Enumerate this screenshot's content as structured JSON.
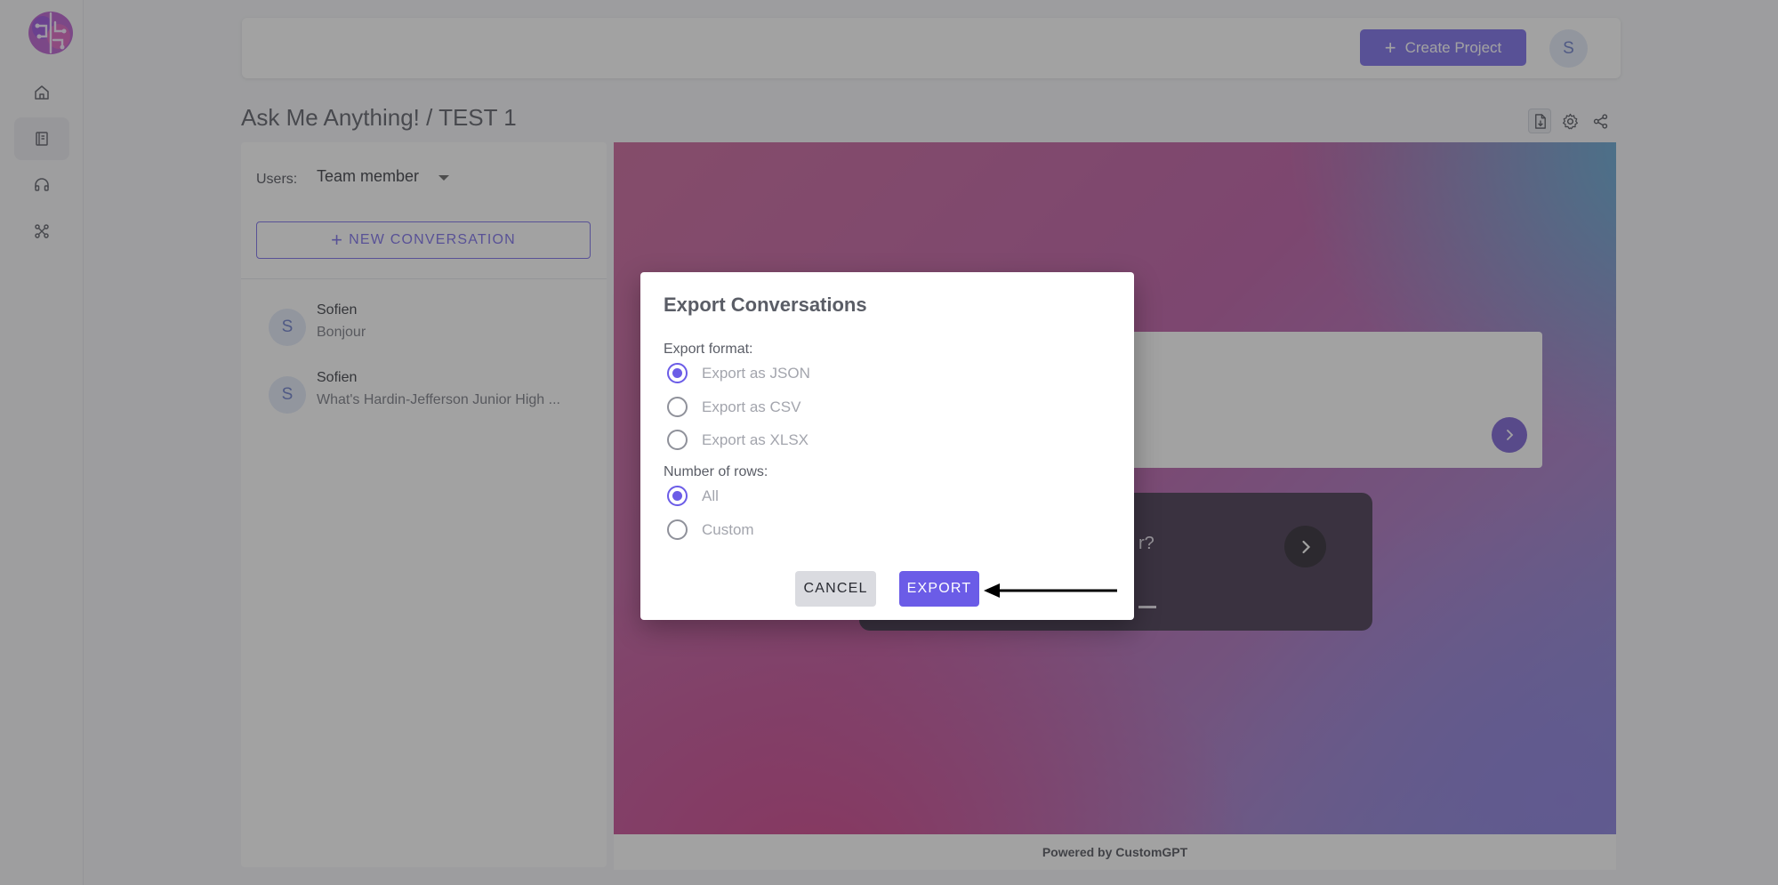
{
  "app": {
    "page_title": "Ask Me Anything! / TEST 1",
    "create_project_label": "Create Project",
    "user_initial": "S",
    "brand_color": "#6b5ce7"
  },
  "sidebar": {
    "items": [
      {
        "name": "home",
        "icon": "home-icon"
      },
      {
        "name": "projects",
        "icon": "book-icon",
        "active": true
      },
      {
        "name": "support",
        "icon": "headphones-icon"
      },
      {
        "name": "integrations",
        "icon": "network-icon"
      }
    ]
  },
  "toolbar": {
    "icons": [
      "export-file-icon",
      "gear-icon",
      "share-icon"
    ]
  },
  "left_panel": {
    "users_label": "Users:",
    "users_value": "Team member",
    "new_conversation_label": "NEW CONVERSATION",
    "conversations": [
      {
        "initial": "S",
        "name": "Sofien",
        "snippet": "Bonjour"
      },
      {
        "initial": "S",
        "name": "Sofien",
        "snippet": "What's Hardin-Jefferson Junior High ..."
      }
    ]
  },
  "chat": {
    "partial_question": "r?",
    "powered_by": "Powered by CustomGPT"
  },
  "dialog": {
    "title": "Export Conversations",
    "format_label": "Export format:",
    "formats": [
      {
        "label": "Export as JSON",
        "checked": true
      },
      {
        "label": "Export as CSV",
        "checked": false
      },
      {
        "label": "Export as XLSX",
        "checked": false
      }
    ],
    "rows_label": "Number of rows:",
    "rows_options": [
      {
        "label": "All",
        "checked": true
      },
      {
        "label": "Custom",
        "checked": false
      }
    ],
    "cancel_label": "CANCEL",
    "export_label": "EXPORT"
  }
}
